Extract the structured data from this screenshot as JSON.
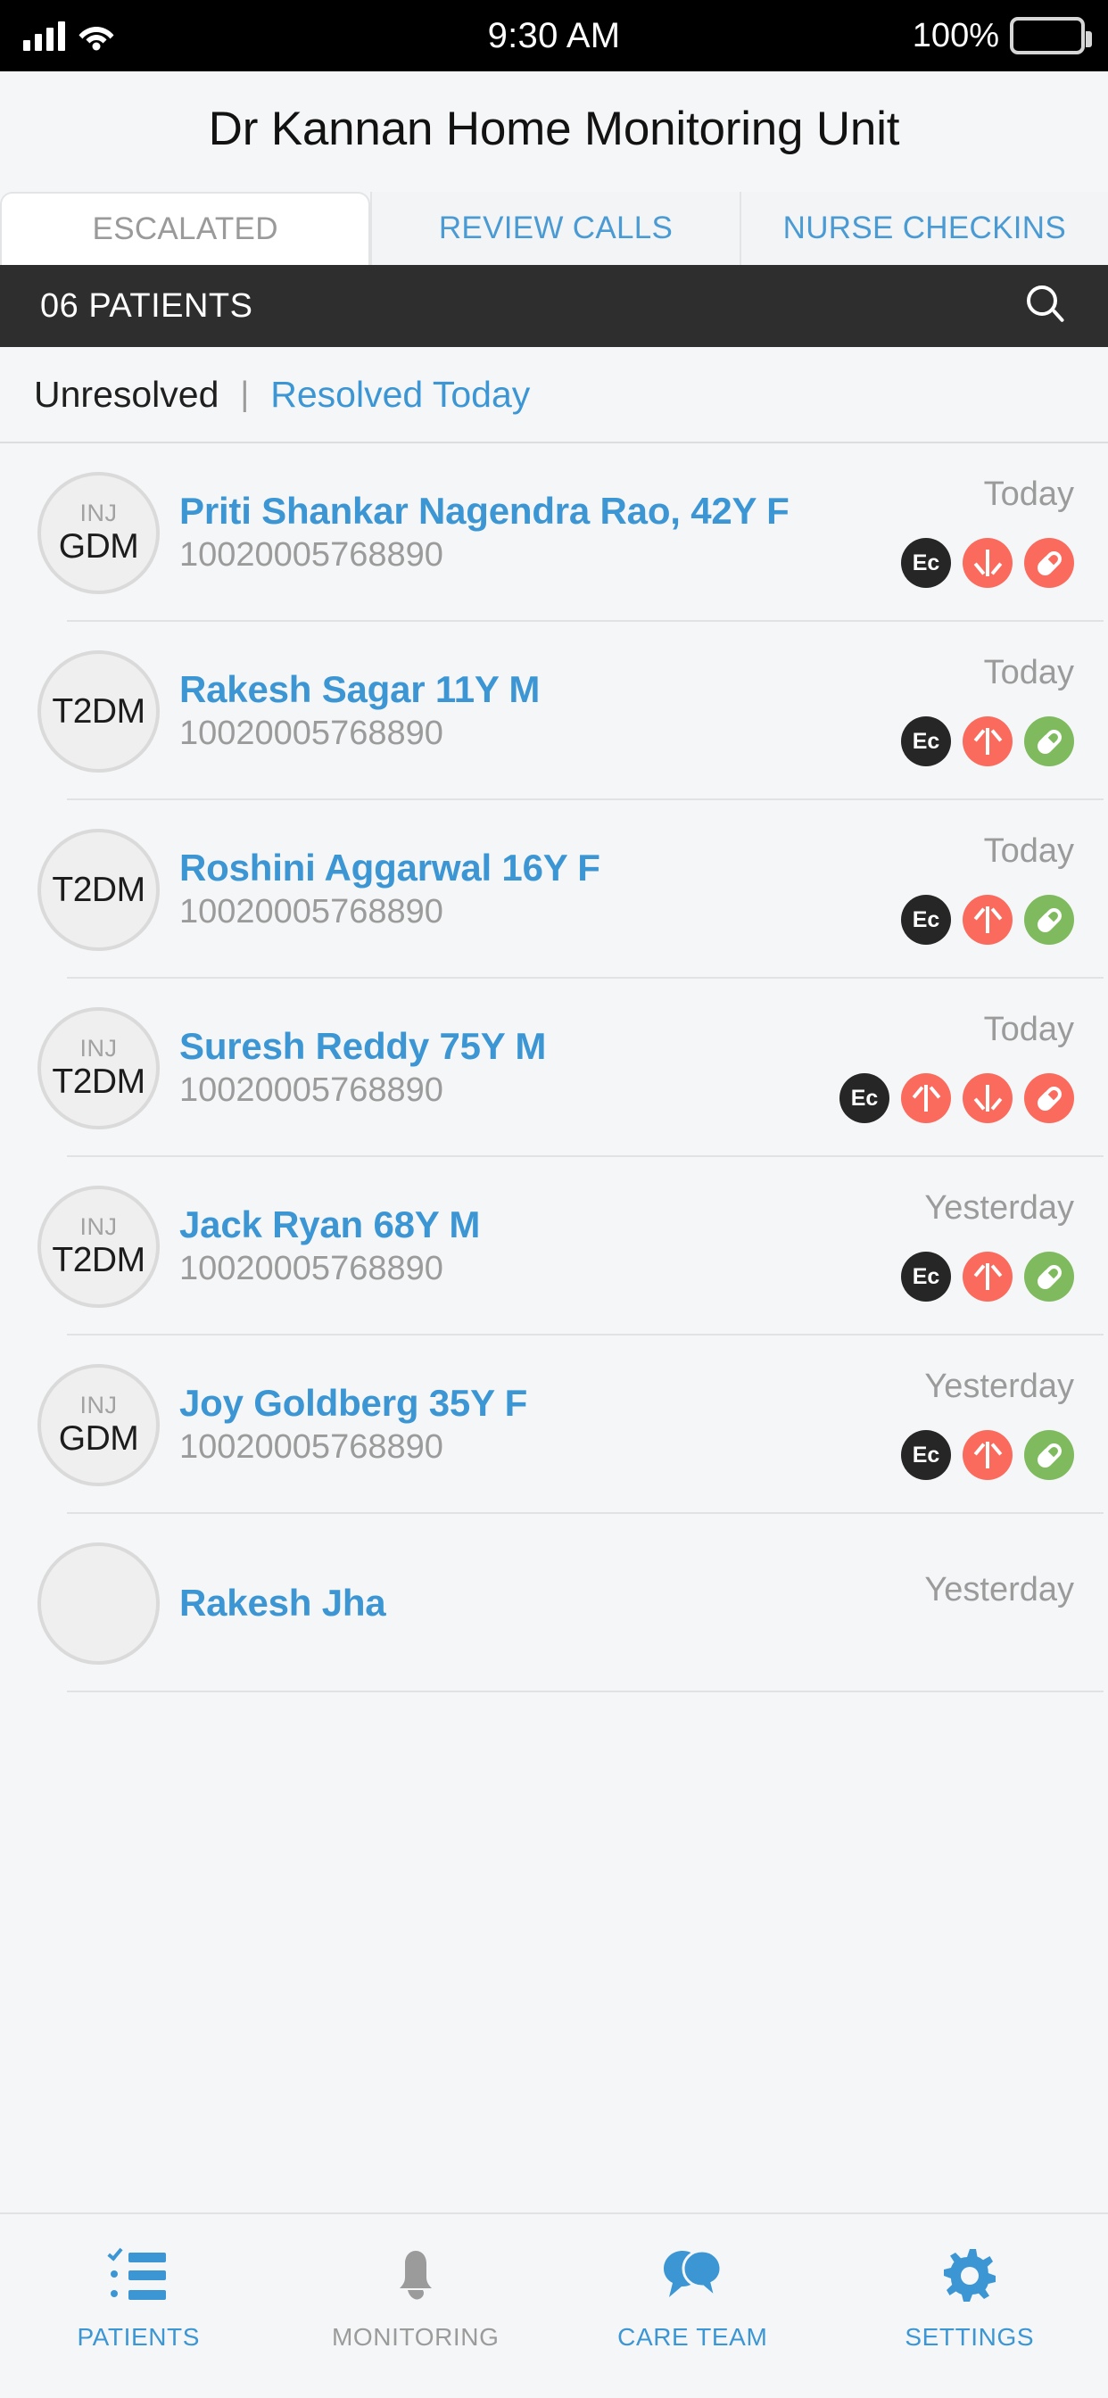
{
  "status_bar": {
    "time": "9:30 AM",
    "battery_percent": "100%",
    "signal_icon": "cellular-signal-icon",
    "wifi_icon": "wifi-icon",
    "battery_icon": "battery-icon"
  },
  "header": {
    "title": "Dr Kannan Home Monitoring Unit"
  },
  "tabs": [
    {
      "label": "ESCALATED",
      "active": true
    },
    {
      "label": "REVIEW CALLS",
      "active": false
    },
    {
      "label": "NURSE CHECKINS",
      "active": false
    }
  ],
  "count_bar": {
    "label": "06 PATIENTS",
    "search_icon": "search-icon"
  },
  "filters": {
    "active": "Unresolved",
    "separator": "|",
    "inactive": "Resolved Today"
  },
  "patients": [
    {
      "inj": "INJ",
      "code": "GDM",
      "name": "Priti Shankar Nagendra Rao, 42Y F",
      "id": "10020005768890",
      "when": "Today",
      "badges": [
        {
          "type": "ec",
          "label": "Ec"
        },
        {
          "type": "arrow-down",
          "color": "#fa6b5e"
        },
        {
          "type": "pill",
          "color": "#fa6b5e"
        }
      ]
    },
    {
      "inj": "",
      "code": "T2DM",
      "name": "Rakesh Sagar 11Y M",
      "id": "10020005768890",
      "when": "Today",
      "badges": [
        {
          "type": "ec",
          "label": "Ec"
        },
        {
          "type": "arrow-up",
          "color": "#fa6b5e"
        },
        {
          "type": "pill",
          "color": "#7fbb5e"
        }
      ]
    },
    {
      "inj": "",
      "code": "T2DM",
      "name": "Roshini Aggarwal 16Y F",
      "id": "10020005768890",
      "when": "Today",
      "badges": [
        {
          "type": "ec",
          "label": "Ec"
        },
        {
          "type": "arrow-up",
          "color": "#fa6b5e"
        },
        {
          "type": "pill",
          "color": "#7fbb5e"
        }
      ]
    },
    {
      "inj": "INJ",
      "code": "T2DM",
      "name": "Suresh Reddy 75Y M",
      "id": "10020005768890",
      "when": "Today",
      "badges": [
        {
          "type": "ec",
          "label": "Ec"
        },
        {
          "type": "arrow-up",
          "color": "#fa6b5e"
        },
        {
          "type": "arrow-down",
          "color": "#fa6b5e"
        },
        {
          "type": "pill",
          "color": "#fa6b5e"
        }
      ]
    },
    {
      "inj": "INJ",
      "code": "T2DM",
      "name": "Jack Ryan 68Y M",
      "id": "10020005768890",
      "when": "Yesterday",
      "badges": [
        {
          "type": "ec",
          "label": "Ec"
        },
        {
          "type": "arrow-up",
          "color": "#fa6b5e"
        },
        {
          "type": "pill",
          "color": "#7fbb5e"
        }
      ]
    },
    {
      "inj": "INJ",
      "code": "GDM",
      "name": "Joy Goldberg 35Y F",
      "id": "10020005768890",
      "when": "Yesterday",
      "badges": [
        {
          "type": "ec",
          "label": "Ec"
        },
        {
          "type": "arrow-up",
          "color": "#fa6b5e"
        },
        {
          "type": "pill",
          "color": "#7fbb5e"
        }
      ]
    },
    {
      "inj": "",
      "code": "",
      "name": "Rakesh Jha",
      "id": "",
      "when": "Yesterday",
      "badges": []
    }
  ],
  "bottom_nav": [
    {
      "label": "PATIENTS",
      "icon": "checklist-icon",
      "active": true
    },
    {
      "label": "MONITORING",
      "icon": "bell-icon",
      "active": false
    },
    {
      "label": "CARE TEAM",
      "icon": "chat-bubbles-icon",
      "active": true
    },
    {
      "label": "SETTINGS",
      "icon": "gear-icon",
      "active": true
    }
  ],
  "colors": {
    "accent_blue": "#3c96d4",
    "alert_red": "#fa6b5e",
    "ok_green": "#7fbb5e",
    "dark_bar": "#2e2e2e",
    "page_bg": "#f5f6f7",
    "muted_gray": "#9b9b9b"
  }
}
